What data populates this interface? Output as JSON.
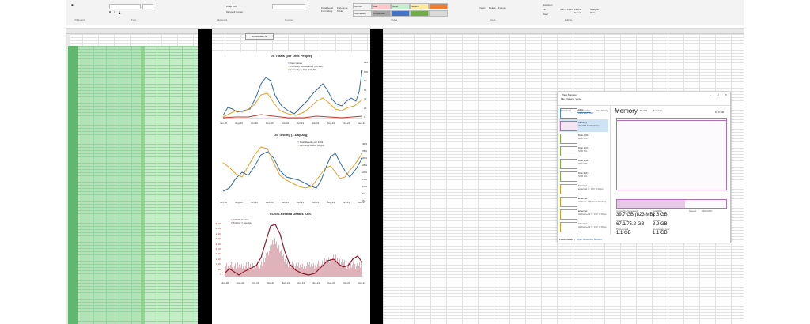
{
  "ribbon": {
    "clipboard_label": "Clipboard",
    "font_label": "Font",
    "alignment_label": "Alignment",
    "number_label": "Number",
    "styles_label": "Styles",
    "cells_label": "Cells",
    "editing_label": "Editing",
    "wrap_text": "Wrap Text",
    "merge_center": "Merge & Center",
    "conditional_formatting": "Conditional Formatting",
    "format_as_table": "Format as Table",
    "styles": [
      {
        "label": "Normal",
        "color": "#ffffff"
      },
      {
        "label": "Bad",
        "color": "#ffc7ce"
      },
      {
        "label": "Good",
        "color": "#c6efce"
      },
      {
        "label": "Neutral",
        "color": "#ffeb9c"
      },
      {
        "label": "Calculation",
        "color": "#f2f2f2"
      },
      {
        "label": "Check Cell",
        "color": "#a5a5a5"
      }
    ],
    "insert": "Insert",
    "delete": "Delete",
    "format": "Format",
    "autosum": "AutoSum",
    "fill": "Fill",
    "clear": "Clear",
    "sort_filter": "Sort & Filter",
    "find_select": "Find & Select",
    "analyze_data": "Analyze Data"
  },
  "top_button": "Recalculate All",
  "charts": {
    "totals": {
      "title": "US Totals (per 100k People)",
      "legend": [
        "New Cases",
        "Currently Hospitalized (COVID)",
        "Currently in ICU (COVID)"
      ],
      "legend_colors": [
        "#2e6aa6",
        "#e3a02b",
        "#c0392b"
      ],
      "y_ticks": [
        "120",
        "100",
        "80",
        "60",
        "40",
        "20",
        "0"
      ],
      "x_ticks": [
        "Jan-20",
        "Aug-20",
        "Oct-20",
        "Dec-20",
        "Feb-21",
        "Apr-21",
        "Jun-21",
        "Aug-21",
        "Oct-21",
        "Dec-21"
      ]
    },
    "testing": {
      "title": "US Testing (7-Day Avg)",
      "legend": [
        "Total Results per 100k",
        "Percent Positive (Right)"
      ],
      "legend_colors": [
        "#2e6aa6",
        "#e3a02b"
      ],
      "y_ticks_right": [
        "40%",
        "35%",
        "30%",
        "25%",
        "20%",
        "15%",
        "10%",
        "5%",
        "0%"
      ],
      "x_ticks": [
        "Jun-20",
        "Aug-20",
        "Oct-20",
        "Dec-20",
        "Feb-21",
        "Apr-21",
        "Jun-21",
        "Aug-21",
        "Oct-21",
        "Dec-21"
      ]
    },
    "deaths": {
      "title": "COVID-Related Deaths (U.S.)",
      "legend": [
        "COVID Deaths",
        "Trailing 7-Day Avg"
      ],
      "legend_colors": [
        "#d9a0a8",
        "#8b1a2b"
      ],
      "y_ticks": [
        "5,000",
        "4,500",
        "4,000",
        "3,500",
        "3,000",
        "2,500",
        "2,000",
        "1,500",
        "1,000",
        "500",
        "0"
      ],
      "x_ticks": [
        "Jun-20",
        "Aug-20",
        "Oct-20",
        "Dec-20",
        "Feb-21",
        "Apr-21",
        "Jun-21",
        "Aug-21",
        "Oct-21",
        "Dec-21"
      ]
    }
  },
  "task_manager": {
    "title": "Task Manager",
    "menu": [
      "File",
      "Options",
      "View"
    ],
    "tabs": [
      "Processes",
      "Performance",
      "App history",
      "Startup",
      "Users",
      "Details",
      "Services"
    ],
    "side_items": [
      {
        "label": "CPU",
        "sub": "34% 2.87 GHz",
        "color": "#4a90d9"
      },
      {
        "label": "Memory",
        "sub": "39.7/63.8 GB (62%)",
        "color": "#b56fb5"
      },
      {
        "label": "Disk 0 (D:)",
        "sub": "HDD 0%",
        "color": "#7cb342"
      },
      {
        "label": "Disk 1 (C:)",
        "sub": "SSD 1%",
        "color": "#7cb342"
      },
      {
        "label": "Disk 2 (E:)",
        "sub": "HDD 0%",
        "color": "#7cb342"
      },
      {
        "label": "Disk 3 (F:)",
        "sub": "SSD 0%",
        "color": "#7cb342"
      },
      {
        "label": "Ethernet",
        "sub": "Ethernet S: 0 R: 0 Kbps",
        "color": "#d4a017"
      },
      {
        "label": "Ethernet",
        "sub": "vEthernet (Default Switch)",
        "color": "#d4a017"
      },
      {
        "label": "Ethernet",
        "sub": "vEthernet 2 S: 0 R: 0 Kbps",
        "color": "#d4a017"
      },
      {
        "label": "Ethernet",
        "sub": "vEthernet 3 S: 0 R: 0 Kbps",
        "color": "#d4a017"
      }
    ],
    "main_title": "Memory",
    "main_total": "64.0 GB",
    "in_use_label": "In use (Compressed)",
    "in_use_value": "39.7 GB (823 MB)",
    "available_label": "Available",
    "available_value": "2.8 GB",
    "committed_label": "Committed",
    "committed_value": "67.1/75.2 GB",
    "cached_label": "Cached",
    "cached_value": "3.9 GB",
    "paged_label": "Paged pool",
    "paged_value": "1.1 GB",
    "nonpaged_label": "Non-paged pool",
    "nonpaged_value": "1.1 GB",
    "speed_label": "Speed:",
    "speed_value": "2400 MHz",
    "fewer_details": "Fewer details",
    "open_resource_monitor": "Open Resource Monitor"
  }
}
